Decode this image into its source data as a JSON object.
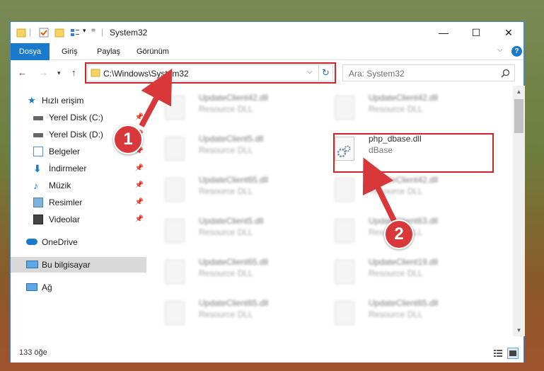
{
  "window": {
    "title": "System32",
    "controls": {
      "minimize": "—",
      "maximize": "☐",
      "close": "✕"
    }
  },
  "ribbon": {
    "tabs": [
      "Dosya",
      "Giriş",
      "Paylaş",
      "Görünüm"
    ]
  },
  "address": {
    "path": "C:\\Windows\\System32"
  },
  "search": {
    "placeholder": "Ara: System32"
  },
  "sidebar": {
    "items": [
      {
        "label": "Hızlı erişim",
        "icon": "star-icon"
      },
      {
        "label": "Yerel Disk (C:)",
        "icon": "drive-icon"
      },
      {
        "label": "Yerel Disk (D:)",
        "icon": "drive-icon"
      },
      {
        "label": "Belgeler",
        "icon": "documents-icon"
      },
      {
        "label": "İndirmeler",
        "icon": "download-icon"
      },
      {
        "label": "Müzik",
        "icon": "music-icon"
      },
      {
        "label": "Resimler",
        "icon": "pictures-icon"
      },
      {
        "label": "Videolar",
        "icon": "videos-icon"
      },
      {
        "label": "OneDrive",
        "icon": "cloud-icon"
      },
      {
        "label": "Bu bilgisayar",
        "icon": "computer-icon"
      },
      {
        "label": "Ağ",
        "icon": "network-icon"
      }
    ]
  },
  "files": {
    "col1": [
      {
        "name": "UpdateClient42.dll",
        "type": "Resource DLL"
      },
      {
        "name": "UpdateClient5.dll",
        "type": "Resource DLL"
      },
      {
        "name": "UpdateClient65.dll",
        "type": "Resource DLL"
      },
      {
        "name": "UpdateClient5.dll",
        "type": "Resource DLL"
      },
      {
        "name": "UpdateClient65.dll",
        "type": "Resource DLL"
      },
      {
        "name": "UpdateClient65.dll",
        "type": "Resource DLL"
      }
    ],
    "col2": [
      {
        "name": "UpdateClient42.dll",
        "type": "Resource DLL"
      },
      {
        "name": "php_dbase.dll",
        "type": "dBase"
      },
      {
        "name": "UpdateClient42.dll",
        "type": "Resource DLL"
      },
      {
        "name": "UpdateClient63.dll",
        "type": "Resource DLL"
      },
      {
        "name": "UpdateClient19.dll",
        "type": "Resource DLL"
      },
      {
        "name": "UpdateClient65.dll",
        "type": "Resource DLL"
      }
    ]
  },
  "status": {
    "count": "133 öğe"
  },
  "annotations": {
    "step1": "1",
    "step2": "2",
    "accent": "#d9383a"
  }
}
